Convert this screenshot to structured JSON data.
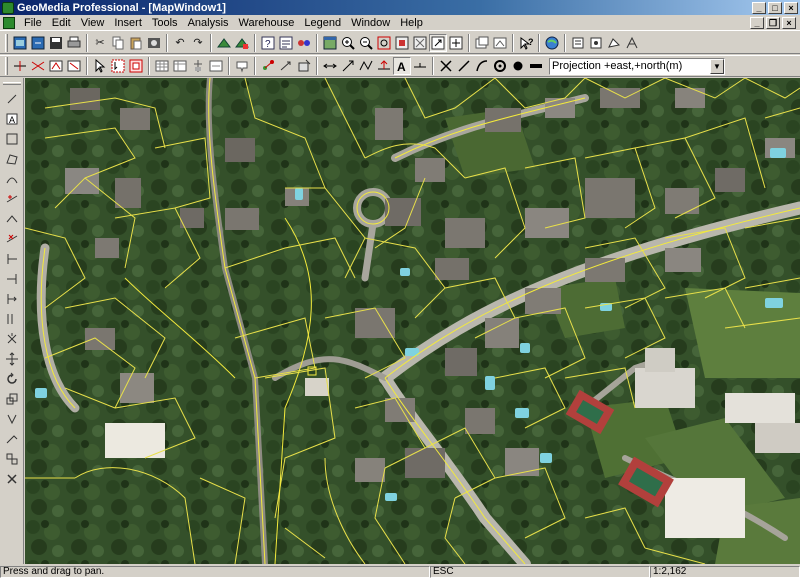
{
  "window": {
    "title": "GeoMedia Professional - [MapWindow1]"
  },
  "menu": {
    "items": [
      "File",
      "Edit",
      "View",
      "Insert",
      "Tools",
      "Analysis",
      "Warehouse",
      "Legend",
      "Window",
      "Help"
    ]
  },
  "toolbar": {
    "projection_value": "Projection +east,+north(m)"
  },
  "statusbar": {
    "message": "Press and drag to pan.",
    "key_hint": "ESC",
    "scale": "1:2,162"
  },
  "colors": {
    "title_active": "#0a246a",
    "parcel_lines": "#e8e04a",
    "chrome": "#d4d0c8"
  }
}
